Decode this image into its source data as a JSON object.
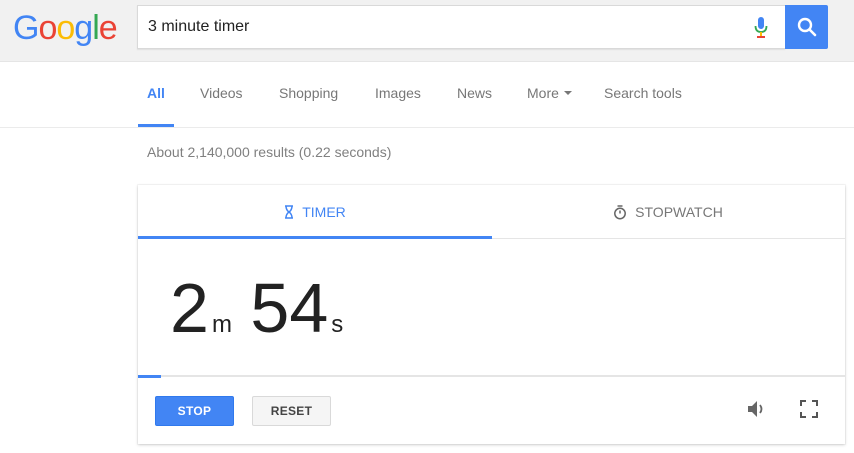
{
  "logo": {
    "letters": [
      "G",
      "o",
      "o",
      "g",
      "l",
      "e"
    ],
    "colors": [
      "#4285f4",
      "#ea4335",
      "#fbbc05",
      "#4285f4",
      "#34a853",
      "#ea4335"
    ]
  },
  "search": {
    "value": "3 minute timer",
    "placeholder": ""
  },
  "icons": {
    "mic": "microphone-icon",
    "search": "magnifier-icon",
    "timer": "hourglass-icon",
    "stopwatch": "stopwatch-icon",
    "sound": "speaker-icon",
    "fullscreen": "fullscreen-icon"
  },
  "nav": {
    "items": [
      {
        "label": "All",
        "active": true
      },
      {
        "label": "Videos"
      },
      {
        "label": "Shopping"
      },
      {
        "label": "Images"
      },
      {
        "label": "News"
      },
      {
        "label": "More"
      },
      {
        "label": "Search tools"
      }
    ]
  },
  "results": {
    "stats": "About 2,140,000 results (0.22 seconds)"
  },
  "timer": {
    "tabs": {
      "timer": "TIMER",
      "stopwatch": "STOPWATCH"
    },
    "minutes": "2",
    "minutes_unit": "m",
    "seconds": "54",
    "seconds_unit": "s",
    "progress_fraction": 0.033,
    "stop_label": "STOP",
    "reset_label": "RESET"
  },
  "colors": {
    "accent": "#4285f4",
    "text": "#222222",
    "muted": "#777777"
  }
}
